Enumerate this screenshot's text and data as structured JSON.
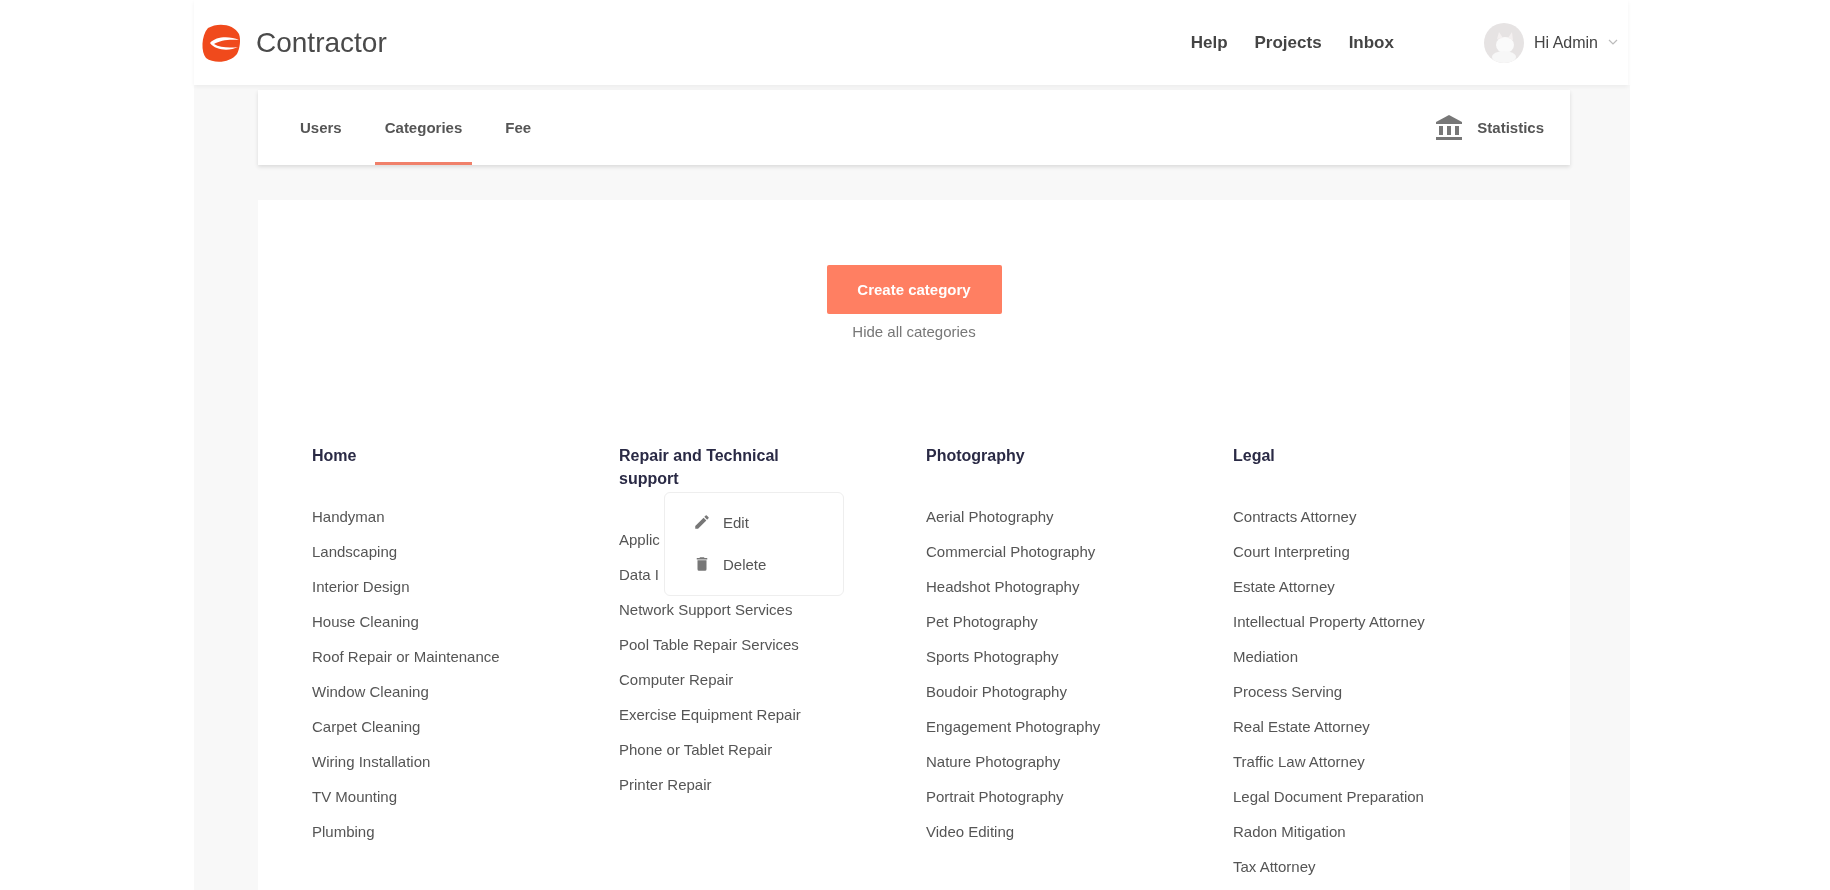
{
  "header": {
    "brand": "Contractor",
    "nav": [
      "Help",
      "Projects",
      "Inbox"
    ],
    "user": "Hi Admin"
  },
  "tabs": [
    {
      "label": "Users",
      "selected": false
    },
    {
      "label": "Categories",
      "selected": true
    },
    {
      "label": "Fee",
      "selected": false
    }
  ],
  "statistics": "Statistics",
  "create_button": "Create category",
  "hide_link": "Hide all categories",
  "categories": [
    {
      "title": "Home",
      "items": [
        "Handyman",
        "Landscaping",
        "Interior Design",
        "House Cleaning",
        "Roof Repair or Maintenance",
        "Window Cleaning",
        "Carpet Cleaning",
        "Wiring Installation",
        "TV Mounting",
        "Plumbing"
      ]
    },
    {
      "title": "Repair and Technical support",
      "items": [
        "Applic",
        "Data I",
        "Network Support Services",
        "Pool Table Repair Services",
        "Computer Repair",
        "Exercise Equipment Repair",
        "Phone or Tablet Repair",
        "Printer Repair"
      ],
      "menu": [
        {
          "label": "Edit",
          "kind": "edit"
        },
        {
          "label": "Delete",
          "kind": "delete"
        }
      ]
    },
    {
      "title": "Photography",
      "items": [
        "Aerial Photography",
        "Commercial Photography",
        "Headshot Photography",
        "Pet Photography",
        "Sports Photography",
        "Boudoir Photography",
        "Engagement Photography",
        "Nature Photography",
        "Portrait Photography",
        "Video Editing"
      ]
    },
    {
      "title": "Legal",
      "items": [
        "Contracts Attorney",
        "Court Interpreting",
        "Estate Attorney",
        "Intellectual Property Attorney",
        "Mediation",
        "Process Serving",
        "Real Estate Attorney",
        "Traffic Law Attorney",
        "Legal Document Preparation",
        "Radon Mitigation",
        "Tax Attorney"
      ]
    }
  ]
}
